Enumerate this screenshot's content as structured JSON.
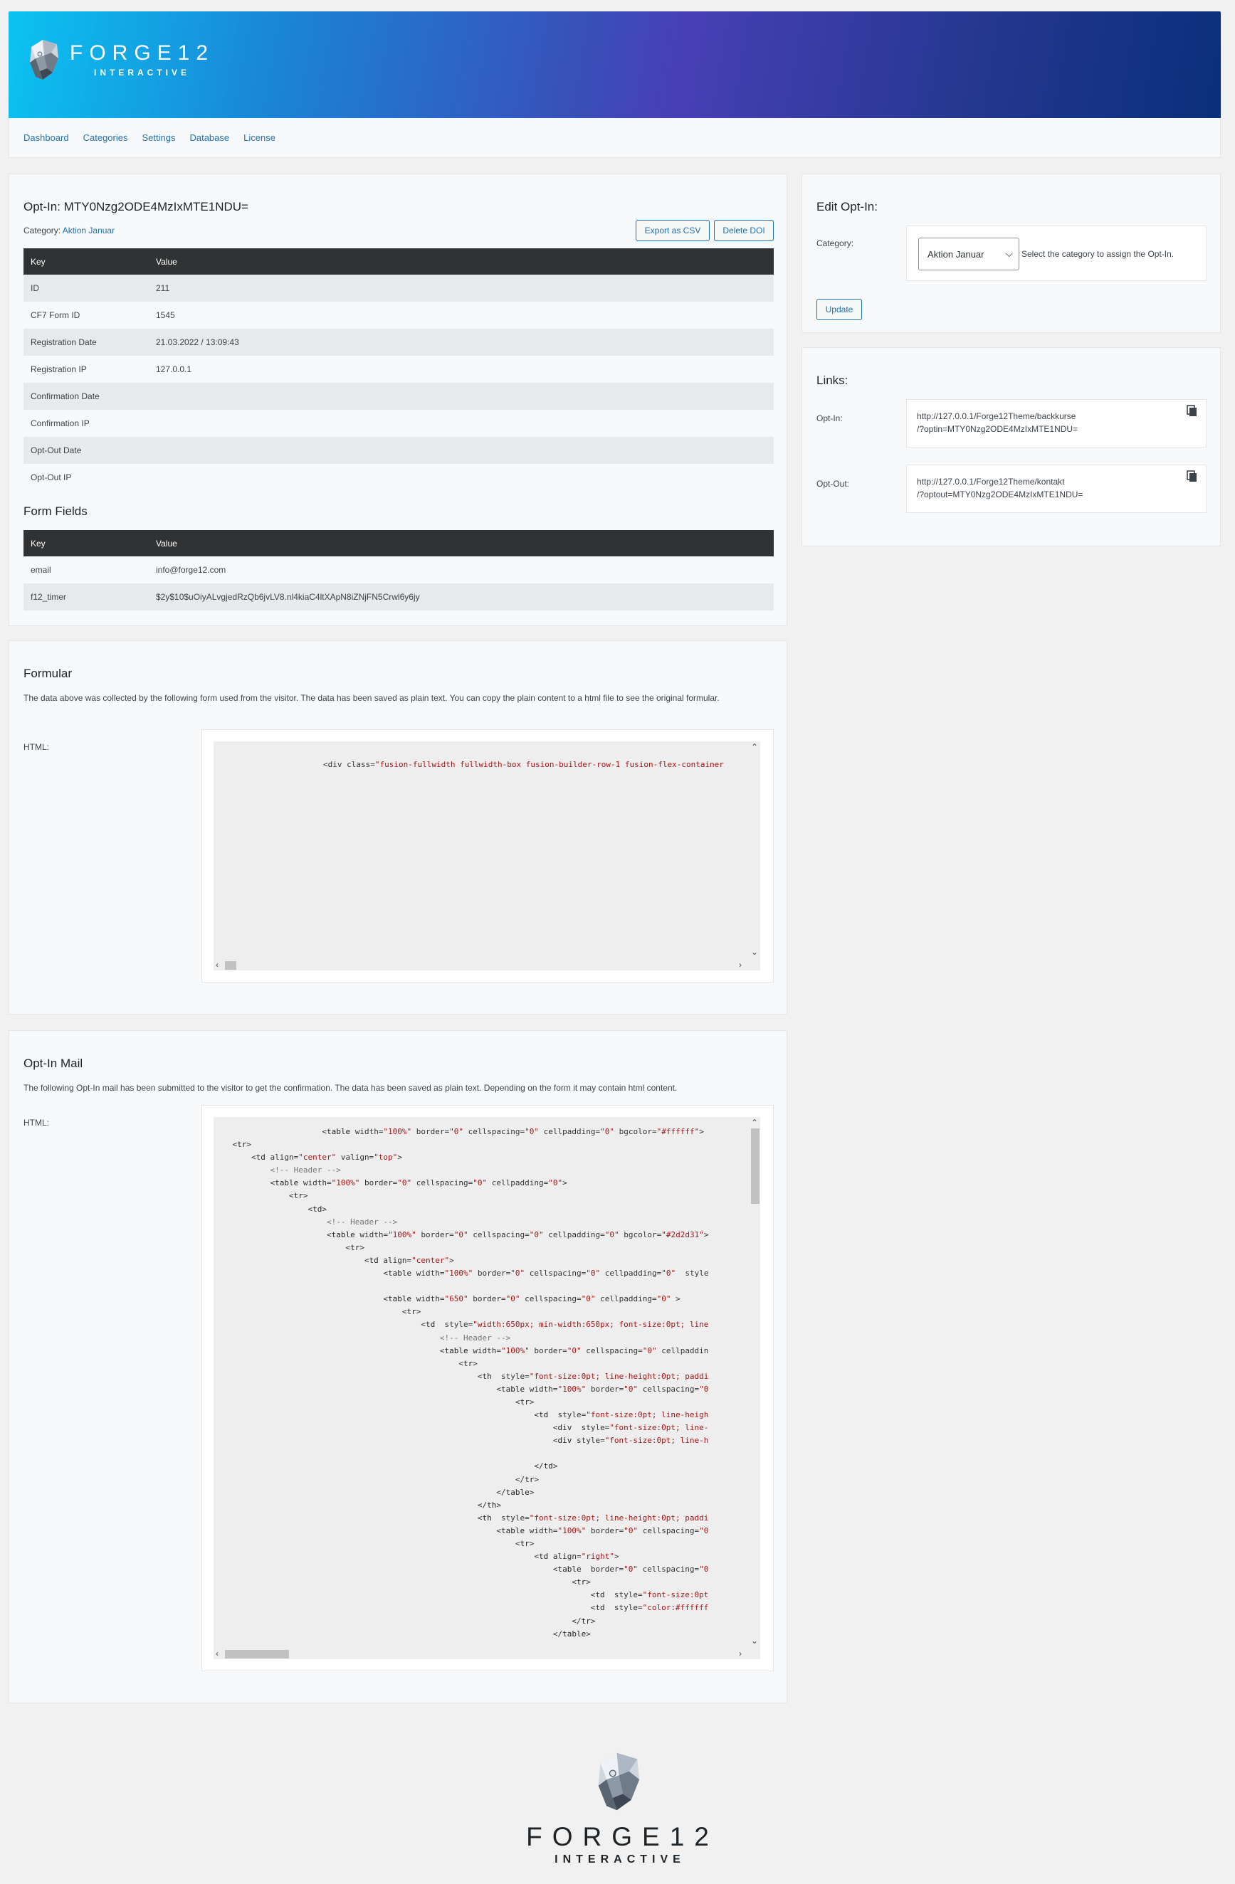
{
  "brand": {
    "name": "FORGE12",
    "subtitle": "INTERACTIVE"
  },
  "nav": [
    "Dashboard",
    "Categories",
    "Settings",
    "Database",
    "License"
  ],
  "optin": {
    "title": "Opt-In: MTY0Nzg2ODE4MzIxMTE1NDU=",
    "category_label": "Category:",
    "category_value": "Aktion Januar",
    "export_button": "Export as CSV",
    "delete_button": "Delete DOI",
    "table_headers": [
      "Key",
      "Value"
    ],
    "rows": [
      [
        "ID",
        "211"
      ],
      [
        "CF7 Form ID",
        "1545"
      ],
      [
        "Registration Date",
        "21.03.2022 / 13:09:43"
      ],
      [
        "Registration IP",
        "127.0.0.1"
      ],
      [
        "Confirmation Date",
        ""
      ],
      [
        "Confirmation IP",
        ""
      ],
      [
        "Opt-Out Date",
        ""
      ],
      [
        "Opt-Out IP",
        ""
      ]
    ]
  },
  "form_fields": {
    "title": "Form Fields",
    "table_headers": [
      "Key",
      "Value"
    ],
    "rows": [
      [
        "email",
        "info@forge12.com"
      ],
      [
        "f12_timer",
        "$2y$10$uOiyALvgjedRzQb6jvLV8.nl4kiaC4ltXApN8iZNjFN5Crwl6y6jy"
      ]
    ]
  },
  "edit": {
    "title": "Edit Opt-In:",
    "category_label": "Category:",
    "selected": "Aktion Januar",
    "help": "Select the category to assign the Opt-In.",
    "update_button": "Update"
  },
  "links": {
    "title": "Links:",
    "optin_label": "Opt-In:",
    "optin_line1": "http://127.0.0.1/Forge12Theme/backkurse",
    "optin_line2": "/?optin=MTY0Nzg2ODE4MzIxMTE1NDU=",
    "optout_label": "Opt-Out:",
    "optout_line1": "http://127.0.0.1/Forge12Theme/kontakt",
    "optout_line2": "/?optout=MTY0Nzg2ODE4MzIxMTE1NDU="
  },
  "formular": {
    "title": "Formular",
    "description": "The data above was collected by the following form used from the visitor. The data has been saved as plain text. You can copy the plain content to a html file to see the original formular.",
    "html_label": "HTML:"
  },
  "mail": {
    "title": "Opt-In Mail",
    "description": "The following Opt-In mail has been submitted to the visitor to get the confirmation. The data has been saved as plain text. Depending on the form it may contain html content.",
    "html_label": "HTML:"
  }
}
